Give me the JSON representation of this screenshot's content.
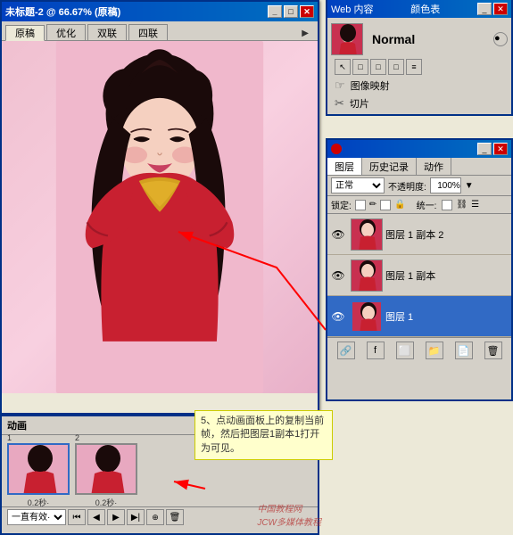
{
  "main_window": {
    "title": "未标题-2 @ 66.67% (原稿)",
    "tabs": [
      "原稿",
      "优化",
      "双联",
      "四联"
    ],
    "active_tab": "原稿"
  },
  "web_panel": {
    "title": "Web 内容",
    "subtitle": "颜色表",
    "normal_label": "Normal",
    "menu_items": [
      {
        "icon": "☞",
        "label": "图像映射"
      },
      {
        "icon": "✂",
        "label": "切片"
      }
    ]
  },
  "layers_panel": {
    "title": "图层",
    "tabs": [
      "图层",
      "历史记录",
      "动作"
    ],
    "active_tab": "图层",
    "blend_mode": "正常",
    "opacity_label": "不透明度:",
    "opacity_value": "100%",
    "lock_label": "锁定:",
    "unified_label": "统一:",
    "layers": [
      {
        "name": "图层 1 副本 2",
        "visible": true,
        "selected": false
      },
      {
        "name": "图层 1 副本",
        "visible": true,
        "selected": false
      },
      {
        "name": "图层 1",
        "visible": true,
        "selected": true
      }
    ]
  },
  "anim_panel": {
    "title": "动画",
    "frames": [
      {
        "num": "1",
        "duration": "0.2秒·",
        "selected": true
      },
      {
        "num": "2",
        "duration": "0.2秒·",
        "selected": false
      }
    ],
    "loop_options": [
      "一直有效·"
    ],
    "loop_value": "一直有效·"
  },
  "tooltip": {
    "text": "5、点动画面板上的复制当前帧，然后把图层1副本1打开为可见。"
  },
  "watermark": {
    "line1": "中国教程网",
    "line2": "JCW多媒体教程"
  }
}
